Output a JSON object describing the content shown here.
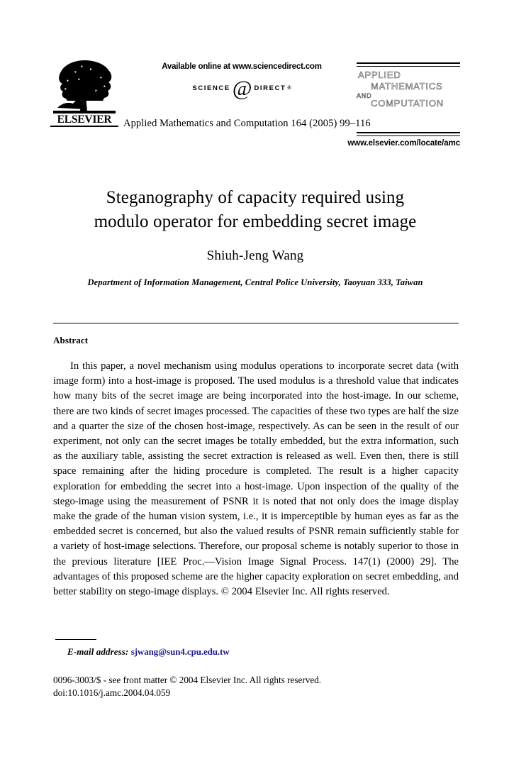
{
  "header": {
    "available_online": "Available online at www.sciencedirect.com",
    "sciencedirect_logo": {
      "left_word": "SCIENCE",
      "at_symbol": "@",
      "right_word": "DIRECT",
      "registered_mark": "®"
    },
    "publisher_name": "ELSEVIER",
    "citation": "Applied Mathematics and Computation 164 (2005) 99–116",
    "journal_logo_lines": [
      "APPLIED",
      "MATHEMATICS",
      "AND",
      "COMPUTATION"
    ],
    "journal_url": "www.elsevier.com/locate/amc"
  },
  "article": {
    "title_line_1": "Steganography of capacity required using",
    "title_line_2": "modulo operator for embedding secret image",
    "author": "Shiuh-Jeng Wang",
    "affiliation": "Department of Information Management, Central Police University, Taoyuan 333, Taiwan"
  },
  "abstract": {
    "heading": "Abstract",
    "body": "In this paper, a novel mechanism using modulus operations to incorporate secret data (with image form) into a host-image is proposed. The used modulus is a threshold value that indicates how many bits of the secret image are being incorporated into the host-image. In our scheme, there are two kinds of secret images processed. The capacities of these two types are half the size and a quarter the size of the chosen host-image, respectively. As can be seen in the result of our experiment, not only can the secret images be totally embedded, but the extra information, such as the auxiliary table, assisting the secret extraction is released as well. Even then, there is still space remaining after the hiding procedure is completed. The result is a higher capacity exploration for embedding the secret into a host-image. Upon inspection of the quality of the stego-image using the measurement of PSNR it is noted that not only does the image display make the grade of the human vision system, i.e., it is imperceptible by human eyes as far as the embedded secret is concerned, but also the valued results of PSNR remain sufficiently stable for a variety of host-image selections. Therefore, our proposal scheme is notably superior to those in the previous literature [IEE Proc.—Vision Image Signal Process. 147(1) (2000) 29]. The advantages of this proposed scheme are the higher capacity exploration on secret embedding, and better stability on stego-image displays. © 2004 Elsevier Inc. All rights reserved."
  },
  "footnote": {
    "email_label": "E-mail address:",
    "email_address": "sjwang@sun4.cpu.edu.tw"
  },
  "footer": {
    "front_matter": "0096-3003/$ - see front matter © 2004 Elsevier Inc. All rights reserved.",
    "doi": "doi:10.1016/j.amc.2004.04.059"
  },
  "colors": {
    "link": "#1b1b8f",
    "text": "#000000",
    "background": "#ffffff"
  }
}
